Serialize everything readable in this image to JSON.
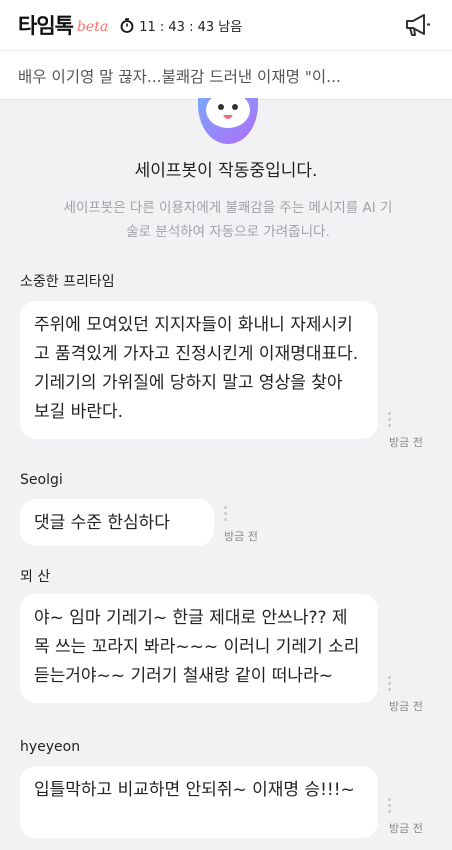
{
  "header": {
    "brand": "타임톡",
    "beta": "beta",
    "timer": "11 : 43 : 43 남음"
  },
  "title": "배우 이기영 말 끊자...불쾌감 드러낸 이재명 \"이...",
  "bot": {
    "title": "세이프봇이 작동중입니다.",
    "description": "세이프봇은 다른 이용자에게 불쾌감을 주는 메시지를 AI 기술로 분석하여 자동으로 가려줍니다."
  },
  "comments": [
    {
      "user": "소중한 프리타임",
      "text": "주위에 모여있던 지지자들이 화내니 자제시키고 품격있게 가자고 진정시킨게 이재명대표다. 기레기의 가위질에 당하지 말고 영상을 찾아 보길 바란다.",
      "time": "방금 전"
    },
    {
      "user": "Seolgi",
      "text": "댓글 수준 한심하다",
      "time": "방금 전"
    },
    {
      "user": "뫼 산",
      "text": "야~ 임마 기레기~ 한글 제대로 안쓰나?? 제목 쓰는 꼬라지 봐라~~~ 이러니 기레기 소리 듣는거야~~ 기러기 철새랑 같이 떠나라~",
      "time": "방금 전"
    },
    {
      "user": "hyeyeon",
      "text": "입틀막하고 비교하면 안되쥐~ 이재명 승!!!~",
      "time": "방금 전"
    }
  ],
  "colors": {
    "accent": "#ff6f6f",
    "background": "#f2f2f5",
    "bubble": "#ffffff"
  }
}
